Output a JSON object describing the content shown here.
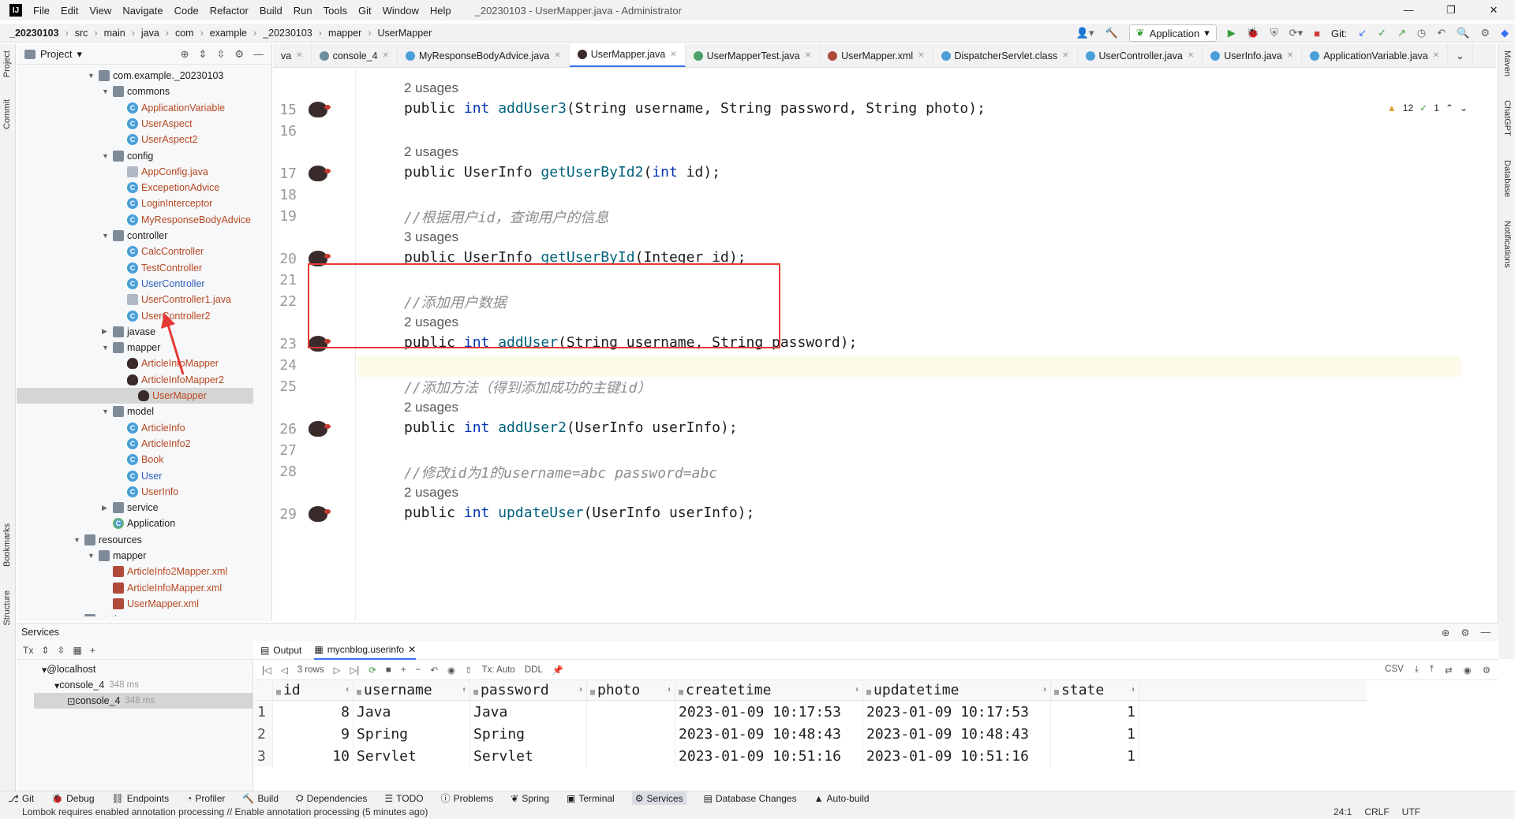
{
  "window": {
    "title": "_20230103 - UserMapper.java - Administrator",
    "menu": [
      "File",
      "Edit",
      "View",
      "Navigate",
      "Code",
      "Refactor",
      "Build",
      "Run",
      "Tools",
      "Git",
      "Window",
      "Help"
    ],
    "controls": [
      "—",
      "❐",
      "✕"
    ]
  },
  "breadcrumb": [
    "_20230103",
    "src",
    "main",
    "java",
    "com",
    "example",
    "_20230103",
    "mapper",
    "UserMapper"
  ],
  "toolbar": {
    "run_config": "Application",
    "git_label": "Git:"
  },
  "left_strip": [
    "Project",
    "Commit",
    "Bookmarks",
    "Structure"
  ],
  "right_strip": [
    "Maven",
    "ChatGPT",
    "Database",
    "Notifications"
  ],
  "project": {
    "title": "Project",
    "tree": [
      {
        "label": "com.example._20230103",
        "type": "folder",
        "open": true,
        "depth": 0
      },
      {
        "label": "commons",
        "type": "folder",
        "open": true,
        "depth": 1
      },
      {
        "label": "ApplicationVariable",
        "type": "class",
        "depth": 2
      },
      {
        "label": "UserAspect",
        "type": "class",
        "depth": 2
      },
      {
        "label": "UserAspect2",
        "type": "class",
        "depth": 2
      },
      {
        "label": "config",
        "type": "folder",
        "open": true,
        "depth": 1
      },
      {
        "label": "AppConfig.java",
        "type": "file",
        "depth": 2
      },
      {
        "label": "ExcepetionAdvice",
        "type": "class",
        "depth": 2
      },
      {
        "label": "LoginInterceptor",
        "type": "class",
        "depth": 2
      },
      {
        "label": "MyResponseBodyAdvice",
        "type": "class",
        "depth": 2
      },
      {
        "label": "controller",
        "type": "folder",
        "open": true,
        "depth": 1
      },
      {
        "label": "CalcController",
        "type": "class",
        "depth": 2
      },
      {
        "label": "TestController",
        "type": "class",
        "depth": 2
      },
      {
        "label": "UserController",
        "type": "class",
        "depth": 2,
        "blue": true
      },
      {
        "label": "UserController1.java",
        "type": "file",
        "depth": 2
      },
      {
        "label": "UserController2",
        "type": "class",
        "depth": 2
      },
      {
        "label": "javase",
        "type": "folder",
        "open": false,
        "depth": 1
      },
      {
        "label": "mapper",
        "type": "folder",
        "open": true,
        "depth": 1
      },
      {
        "label": "ArticleInfoMapper",
        "type": "bird",
        "depth": 2
      },
      {
        "label": "ArticleInfoMapper2",
        "type": "bird",
        "depth": 2
      },
      {
        "label": "UserMapper",
        "type": "bird",
        "depth": 2,
        "selected": true
      },
      {
        "label": "model",
        "type": "folder",
        "open": true,
        "depth": 1
      },
      {
        "label": "ArticleInfo",
        "type": "class",
        "depth": 2
      },
      {
        "label": "ArticleInfo2",
        "type": "class",
        "depth": 2
      },
      {
        "label": "Book",
        "type": "class",
        "depth": 2
      },
      {
        "label": "User",
        "type": "class",
        "depth": 2,
        "blue": true
      },
      {
        "label": "UserInfo",
        "type": "class",
        "depth": 2
      },
      {
        "label": "service",
        "type": "folder",
        "open": false,
        "depth": 1
      },
      {
        "label": "Application",
        "type": "app",
        "depth": 1,
        "plain": true
      },
      {
        "label": "resources",
        "type": "folder",
        "open": true,
        "depth": -1
      },
      {
        "label": "mapper",
        "type": "folder",
        "open": true,
        "depth": 0
      },
      {
        "label": "ArticleInfo2Mapper.xml",
        "type": "xml",
        "depth": 1
      },
      {
        "label": "ArticleInfoMapper.xml",
        "type": "xml",
        "depth": 1
      },
      {
        "label": "UserMapper.xml",
        "type": "xml",
        "depth": 1
      },
      {
        "label": "static",
        "type": "folder",
        "open": true,
        "depth": -1
      }
    ]
  },
  "editor": {
    "tabs": [
      {
        "label": "va",
        "color": ""
      },
      {
        "label": "console_4",
        "color": "#6b8e9f"
      },
      {
        "label": "MyResponseBodyAdvice.java",
        "color": "#4a9fd8"
      },
      {
        "label": "UserMapper.java",
        "color": "#3b2a2a",
        "active": true
      },
      {
        "label": "UserMapperTest.java",
        "color": "#4a9f6a"
      },
      {
        "label": "UserMapper.xml",
        "color": "#b04a3a"
      },
      {
        "label": "DispatcherServlet.class",
        "color": "#4a9fd8"
      },
      {
        "label": "UserController.java",
        "color": "#4a9fd8"
      },
      {
        "label": "UserInfo.java",
        "color": "#4a9fd8"
      },
      {
        "label": "ApplicationVariable.java",
        "color": "#4a9fd8"
      }
    ],
    "inspections": {
      "warnings": "12",
      "checks": "1"
    },
    "lines": [
      {
        "usage": "2 usages"
      },
      {
        "num": "15",
        "bird": true,
        "tokens": [
          [
            "public ",
            ""
          ],
          [
            "int ",
            "kw"
          ],
          [
            "addUser3",
            "fn"
          ],
          [
            "(String username, String password, String photo);",
            ""
          ]
        ]
      },
      {
        "num": "16"
      },
      {
        "usage": "2 usages"
      },
      {
        "num": "17",
        "bird": true,
        "tokens": [
          [
            "public UserInfo ",
            ""
          ],
          [
            "getUserById2",
            "fn"
          ],
          [
            "(",
            ""
          ],
          [
            "int ",
            "kw"
          ],
          [
            "id);",
            ""
          ]
        ]
      },
      {
        "num": "18"
      },
      {
        "num": "19",
        "tokens": [
          [
            "//根据用户id，查询用户的信息",
            "cm"
          ]
        ]
      },
      {
        "usage": "3 usages"
      },
      {
        "num": "20",
        "bird": true,
        "tokens": [
          [
            "public UserInfo ",
            ""
          ],
          [
            "getUserById",
            "fn"
          ],
          [
            "(Integer id);",
            ""
          ]
        ]
      },
      {
        "num": "21"
      },
      {
        "num": "22",
        "tokens": [
          [
            "//添加用户数据",
            "cm"
          ]
        ]
      },
      {
        "usage": "2 usages"
      },
      {
        "num": "23",
        "bird": true,
        "tokens": [
          [
            "public ",
            ""
          ],
          [
            "int ",
            "kw"
          ],
          [
            "addUser",
            "fn"
          ],
          [
            "(String username, String password);",
            ""
          ]
        ]
      },
      {
        "num": "24",
        "current": true
      },
      {
        "num": "25",
        "tokens": [
          [
            "//添加方法（得到添加成功的主键id）",
            "cm"
          ]
        ]
      },
      {
        "usage": "2 usages"
      },
      {
        "num": "26",
        "bird": true,
        "tokens": [
          [
            "public ",
            ""
          ],
          [
            "int ",
            "kw"
          ],
          [
            "addUser2",
            "fn"
          ],
          [
            "(UserInfo userInfo);",
            ""
          ]
        ]
      },
      {
        "num": "27"
      },
      {
        "num": "28",
        "tokens": [
          [
            "//修改id为1的username=abc password=abc",
            "cm"
          ]
        ]
      },
      {
        "usage": "2 usages"
      },
      {
        "num": "29",
        "bird": true,
        "tokens": [
          [
            "public ",
            ""
          ],
          [
            "int ",
            "kw"
          ],
          [
            "updateUser",
            "fn"
          ],
          [
            "(UserInfo userInfo);",
            ""
          ]
        ]
      }
    ]
  },
  "services": {
    "title": "Services",
    "tree": [
      {
        "label": "@localhost",
        "ms": ""
      },
      {
        "label": "console_4",
        "ms": "348 ms"
      },
      {
        "label": "console_4",
        "ms": "348 ms",
        "selected": true
      }
    ],
    "output_tabs": [
      "Output",
      "mycnblog.userinfo"
    ],
    "grid_toolbar": {
      "rows": "3 rows",
      "tx": "Tx: Auto",
      "ddl": "DDL",
      "export": "CSV"
    },
    "columns": [
      "id",
      "username",
      "password",
      "photo",
      "createtime",
      "updatetime",
      "state"
    ],
    "rows": [
      [
        "1",
        "8",
        "Java",
        "Java",
        "",
        "2023-01-09 10:17:53",
        "2023-01-09 10:17:53",
        "1"
      ],
      [
        "2",
        "9",
        "Spring",
        "Spring",
        "",
        "2023-01-09 10:48:43",
        "2023-01-09 10:48:43",
        "1"
      ],
      [
        "3",
        "10",
        "Servlet",
        "Servlet",
        "",
        "2023-01-09 10:51:16",
        "2023-01-09 10:51:16",
        "1"
      ]
    ]
  },
  "bottom_tabs": [
    "Git",
    "Debug",
    "Endpoints",
    "Profiler",
    "Build",
    "Dependencies",
    "TODO",
    "Problems",
    "Spring",
    "Terminal",
    "Services",
    "Database Changes",
    "Auto-build"
  ],
  "status": {
    "message": "Lombok requires enabled annotation processing // Enable annotation processing (5 minutes ago)",
    "position": "24:1",
    "line_sep": "CRLF",
    "encoding": "UTF"
  }
}
